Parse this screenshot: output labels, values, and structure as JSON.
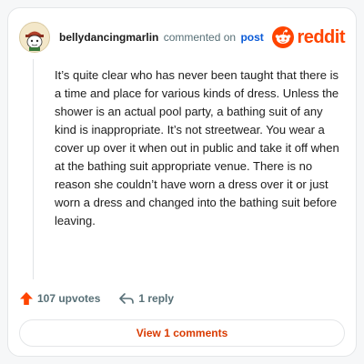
{
  "header": {
    "username": "bellydancingmarlin",
    "verb": "commented on",
    "post_link": "post",
    "brand_name": "reddit",
    "brand_color": "#ff4500",
    "avatar_icon": "snoo-avatar-icon"
  },
  "comment": {
    "text": "It’s quite clear who has never been taught that there is a time and place for various kinds of dress. Unless the shower is an actual pool party, a bathing suit of any kind is inappropriate. It’s not streetwear. You wear a cover up over it when out in public and take it off when at the bathing suit appropriate venue. There is no reason she couldn’t have worn a dress over it or just worn a dress and changed into the bathing suit before leaving."
  },
  "actions": {
    "upvotes_label": "107 upvotes",
    "upvote_icon": "upvote-arrow-icon",
    "upvote_color": "#ff4500",
    "replies_label": "1 reply",
    "reply_icon": "reply-arrow-icon"
  },
  "footer": {
    "view_comments_label": "View 1 comments",
    "link_color": "#d93a00"
  }
}
